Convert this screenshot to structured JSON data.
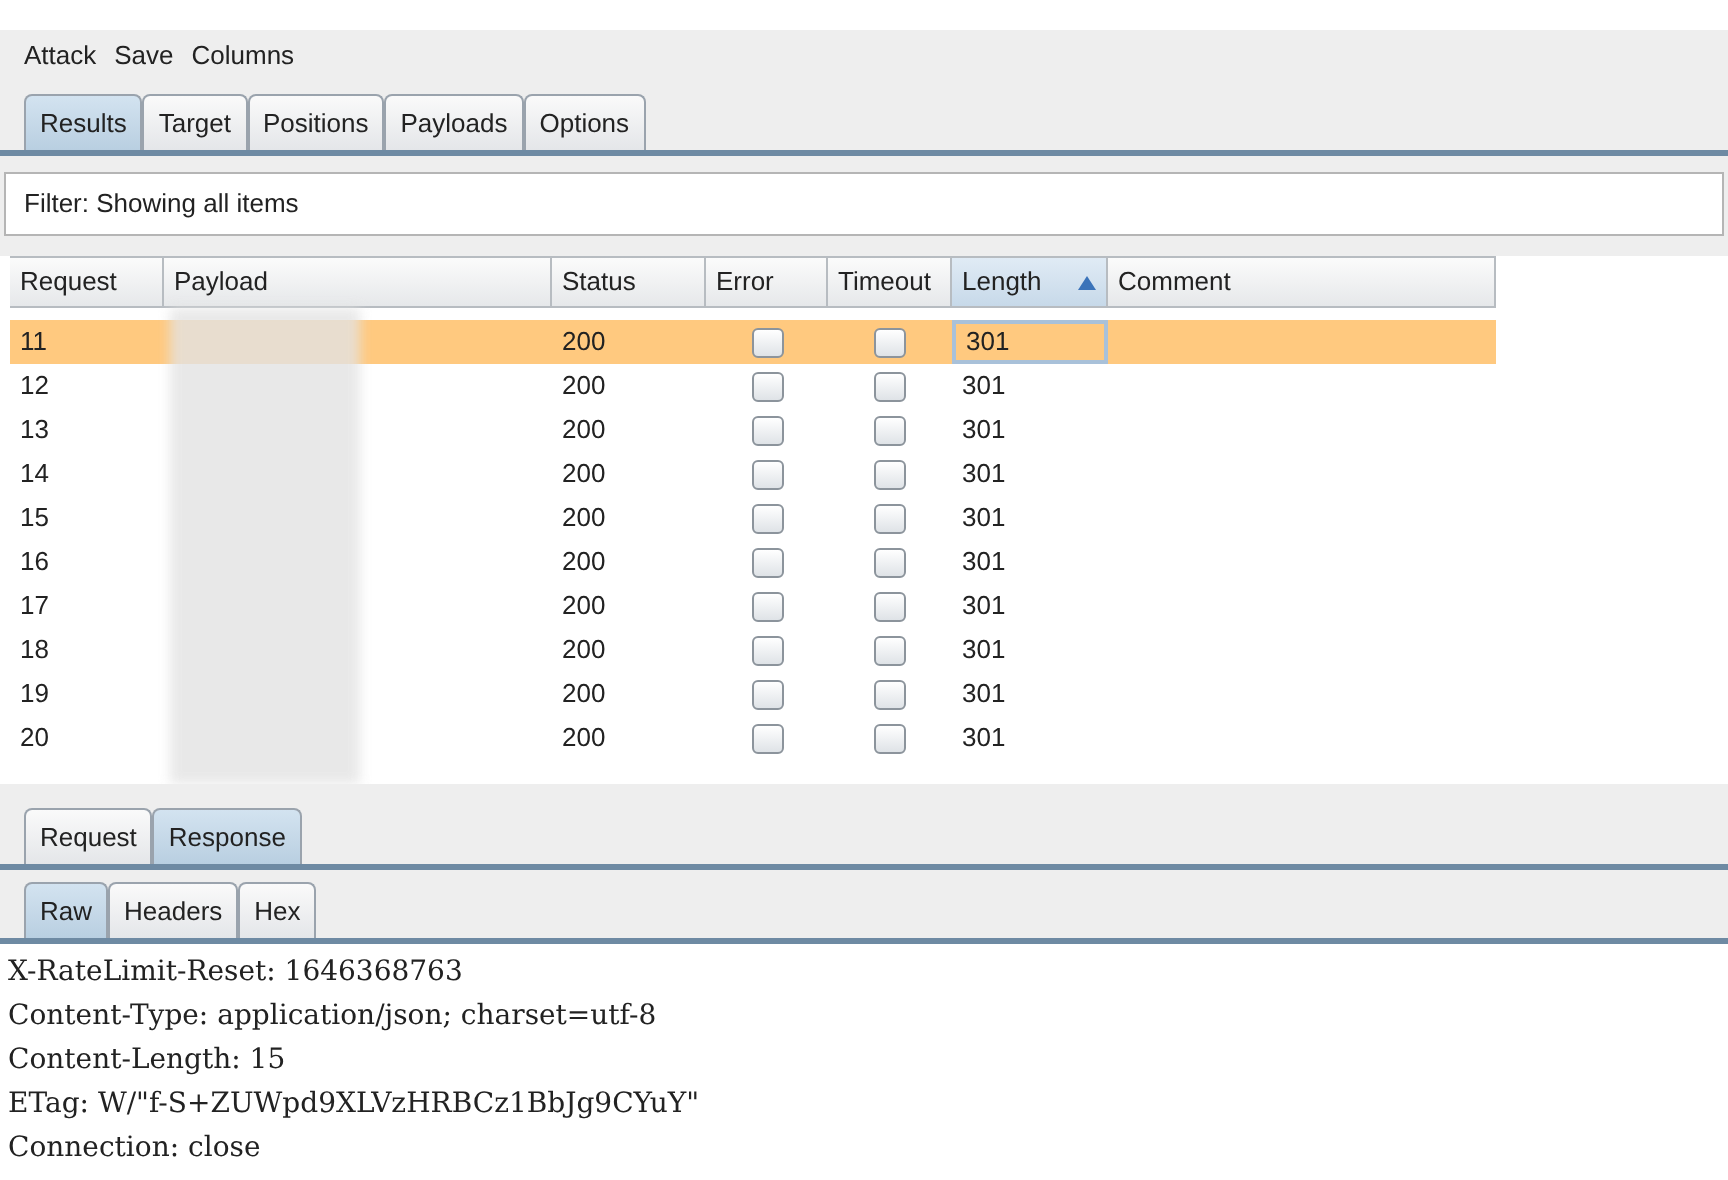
{
  "menu": [
    "Attack",
    "Save",
    "Columns"
  ],
  "tabs": [
    {
      "label": "Results",
      "selected": true
    },
    {
      "label": "Target",
      "selected": false
    },
    {
      "label": "Positions",
      "selected": false
    },
    {
      "label": "Payloads",
      "selected": false
    },
    {
      "label": "Options",
      "selected": false
    }
  ],
  "filter": "Filter: Showing all items",
  "table": {
    "columns": [
      {
        "label": "Request",
        "sorted": false
      },
      {
        "label": "Payload",
        "sorted": false
      },
      {
        "label": "Status",
        "sorted": false
      },
      {
        "label": "Error",
        "sorted": false
      },
      {
        "label": "Timeout",
        "sorted": false
      },
      {
        "label": "Length",
        "sorted": true
      },
      {
        "label": "Comment",
        "sorted": false
      }
    ],
    "rows": [
      {
        "request": "11",
        "status": "200",
        "error": false,
        "timeout": false,
        "length": "301",
        "selected": true
      },
      {
        "request": "12",
        "status": "200",
        "error": false,
        "timeout": false,
        "length": "301",
        "selected": false
      },
      {
        "request": "13",
        "status": "200",
        "error": false,
        "timeout": false,
        "length": "301",
        "selected": false
      },
      {
        "request": "14",
        "status": "200",
        "error": false,
        "timeout": false,
        "length": "301",
        "selected": false
      },
      {
        "request": "15",
        "status": "200",
        "error": false,
        "timeout": false,
        "length": "301",
        "selected": false
      },
      {
        "request": "16",
        "status": "200",
        "error": false,
        "timeout": false,
        "length": "301",
        "selected": false
      },
      {
        "request": "17",
        "status": "200",
        "error": false,
        "timeout": false,
        "length": "301",
        "selected": false
      },
      {
        "request": "18",
        "status": "200",
        "error": false,
        "timeout": false,
        "length": "301",
        "selected": false
      },
      {
        "request": "19",
        "status": "200",
        "error": false,
        "timeout": false,
        "length": "301",
        "selected": false
      },
      {
        "request": "20",
        "status": "200",
        "error": false,
        "timeout": false,
        "length": "301",
        "selected": false
      }
    ]
  },
  "message_tabs": [
    {
      "label": "Request",
      "selected": false
    },
    {
      "label": "Response",
      "selected": true
    }
  ],
  "view_tabs": [
    {
      "label": "Raw",
      "selected": true
    },
    {
      "label": "Headers",
      "selected": false
    },
    {
      "label": "Hex",
      "selected": false
    }
  ],
  "raw_lines": [
    "X-RateLimit-Reset: 1646368763",
    "Content-Type: application/json; charset=utf-8",
    "Content-Length: 15",
    "ETag: W/\"f-S+ZUWpd9XLVzHRBCz1BbJg9CYuY\"",
    "Connection: close"
  ]
}
